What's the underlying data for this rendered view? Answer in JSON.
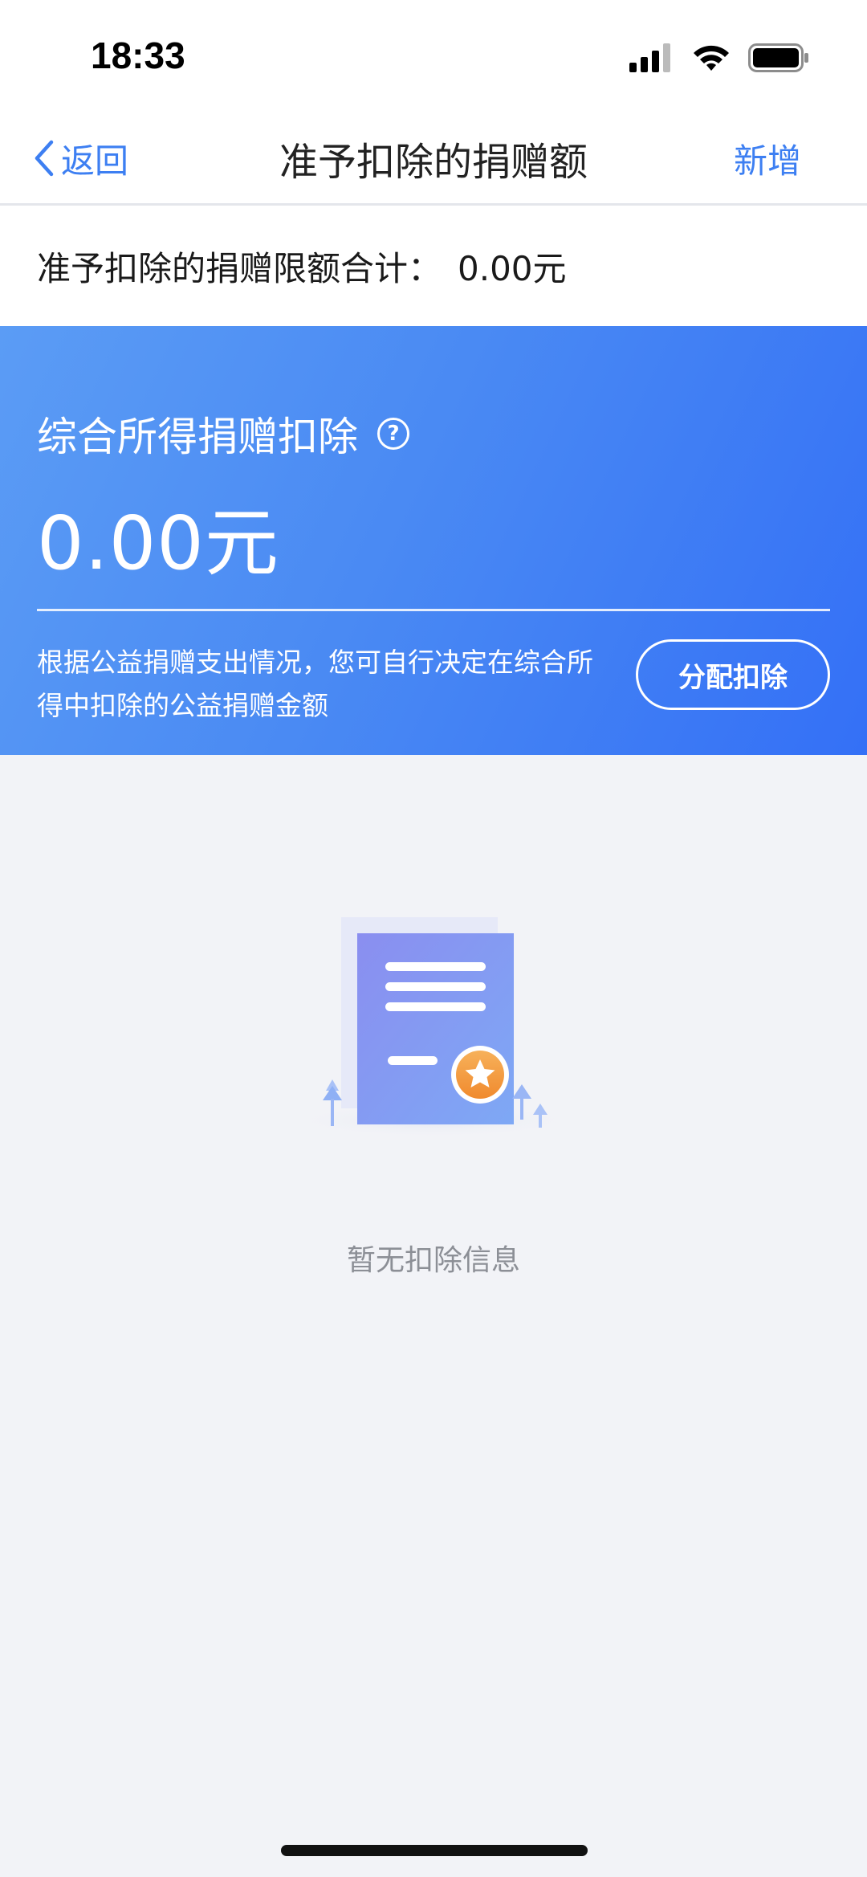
{
  "status_bar": {
    "time": "18:33"
  },
  "nav": {
    "back_label": "返回",
    "title": "准予扣除的捐赠额",
    "add_label": "新增"
  },
  "limit": {
    "label": "准予扣除的捐赠限额合计：",
    "value": "0.00元"
  },
  "card": {
    "heading": "综合所得捐赠扣除",
    "help_glyph": "?",
    "amount": "0.00元",
    "description": "根据公益捐赠支出情况，您可自行决定在综合所得中扣除的公益捐赠金额",
    "allocate_button": "分配扣除",
    "gradient_colors": [
      "#5b9cf5",
      "#3470f6"
    ]
  },
  "empty_state": {
    "text": "暂无扣除信息",
    "icon": "document-certificate-icon"
  },
  "colors": {
    "accent": "#3d7ff2",
    "page_background": "#f2f3f7"
  }
}
